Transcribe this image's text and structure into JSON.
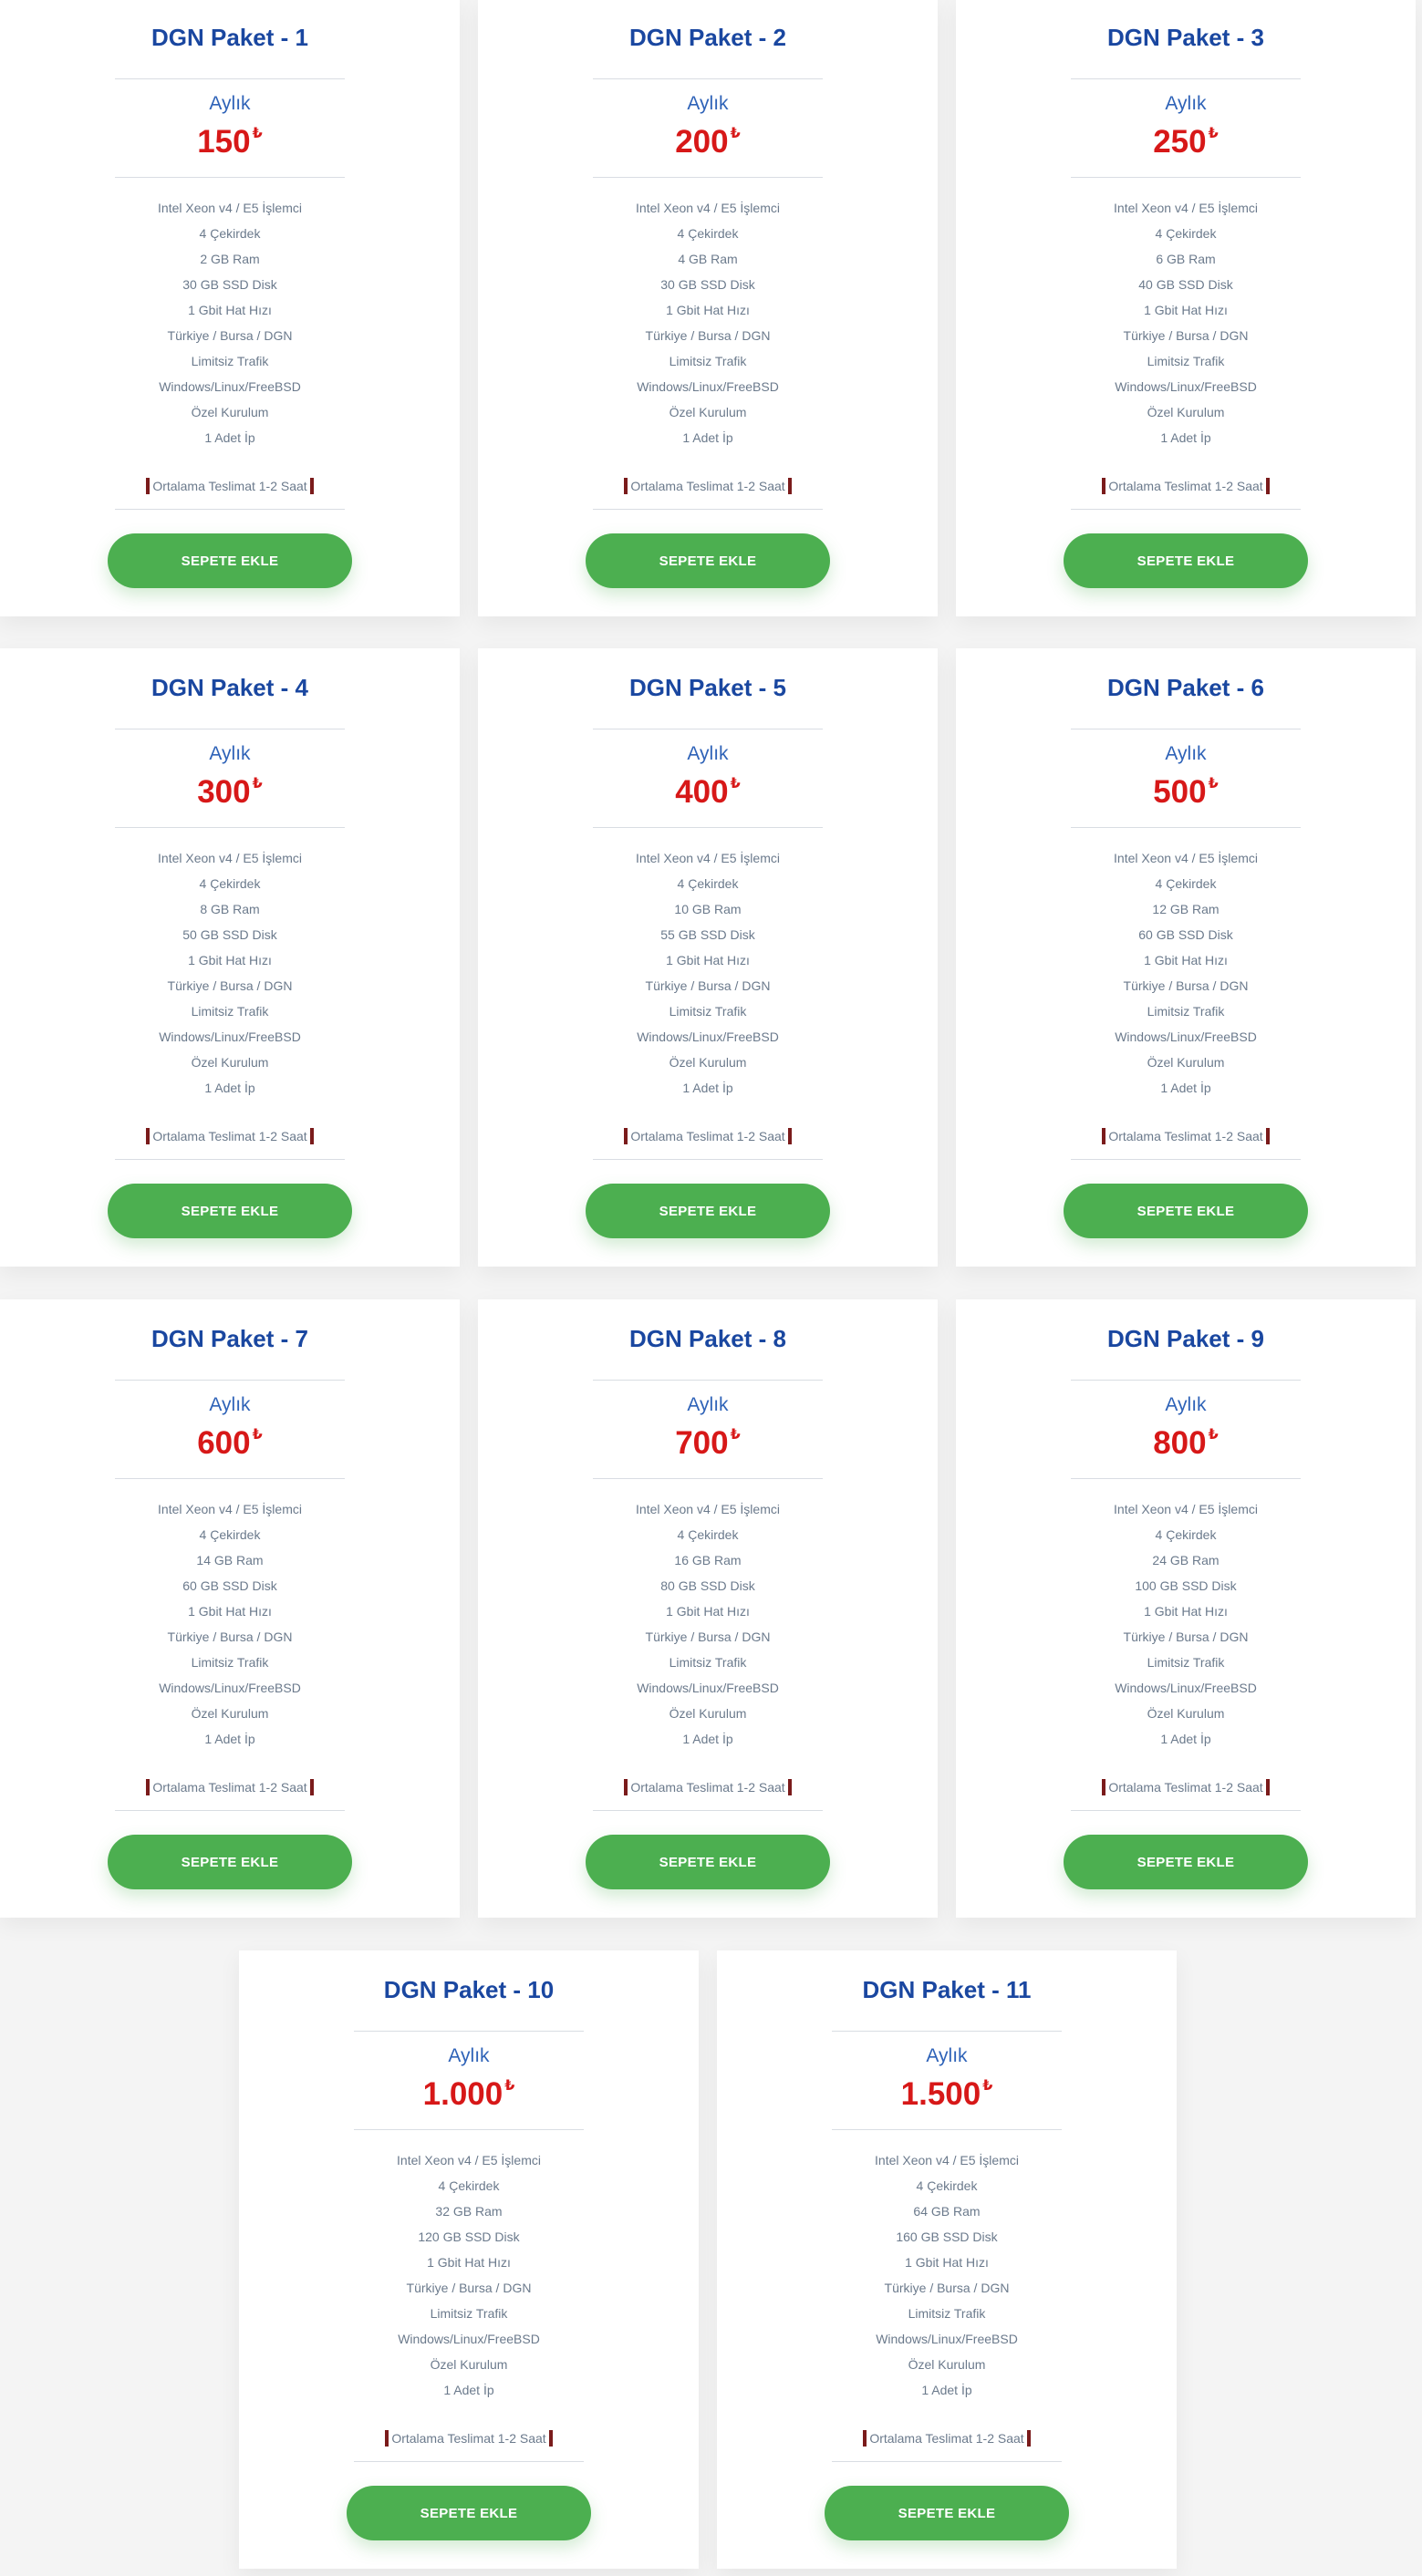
{
  "button_label": "SEPETE EKLE",
  "colors": {
    "title": "#1a47a0",
    "price": "#d71818",
    "button": "#4caf50"
  },
  "packages": [
    {
      "title": "DGN Paket - 1",
      "period": "Aylık",
      "price": "150",
      "currency": "₺",
      "features": [
        "Intel Xeon v4 / E5 İşlemci",
        "4 Çekirdek",
        "2 GB Ram",
        "30 GB SSD Disk",
        "1 Gbit Hat Hızı",
        "Türkiye / Bursa / DGN",
        "Limitsiz Trafik",
        "Windows/Linux/FreeBSD",
        "Özel Kurulum",
        "1 Adet İp"
      ],
      "delivery": "Ortalama Teslimat 1-2 Saat"
    },
    {
      "title": "DGN Paket - 2",
      "period": "Aylık",
      "price": "200",
      "currency": "₺",
      "features": [
        "Intel Xeon v4 / E5 İşlemci",
        "4 Çekirdek",
        "4 GB Ram",
        "30 GB SSD Disk",
        "1 Gbit Hat Hızı",
        "Türkiye / Bursa / DGN",
        "Limitsiz Trafik",
        "Windows/Linux/FreeBSD",
        "Özel Kurulum",
        "1 Adet İp"
      ],
      "delivery": "Ortalama Teslimat 1-2 Saat"
    },
    {
      "title": "DGN Paket - 3",
      "period": "Aylık",
      "price": "250",
      "currency": "₺",
      "features": [
        "Intel Xeon v4 / E5 İşlemci",
        "4 Çekirdek",
        "6 GB Ram",
        "40 GB SSD Disk",
        "1 Gbit Hat Hızı",
        "Türkiye / Bursa / DGN",
        "Limitsiz Trafik",
        "Windows/Linux/FreeBSD",
        "Özel Kurulum",
        "1 Adet İp"
      ],
      "delivery": "Ortalama Teslimat 1-2 Saat"
    },
    {
      "title": "DGN Paket - 4",
      "period": "Aylık",
      "price": "300",
      "currency": "₺",
      "features": [
        "Intel Xeon v4 / E5 İşlemci",
        "4 Çekirdek",
        "8 GB Ram",
        "50 GB SSD Disk",
        "1 Gbit Hat Hızı",
        "Türkiye / Bursa / DGN",
        "Limitsiz Trafik",
        "Windows/Linux/FreeBSD",
        "Özel Kurulum",
        "1 Adet İp"
      ],
      "delivery": "Ortalama Teslimat 1-2 Saat"
    },
    {
      "title": "DGN Paket - 5",
      "period": "Aylık",
      "price": "400",
      "currency": "₺",
      "features": [
        "Intel Xeon v4 / E5 İşlemci",
        "4 Çekirdek",
        "10 GB Ram",
        "55 GB SSD Disk",
        "1 Gbit Hat Hızı",
        "Türkiye / Bursa / DGN",
        "Limitsiz Trafik",
        "Windows/Linux/FreeBSD",
        "Özel Kurulum",
        "1 Adet İp"
      ],
      "delivery": "Ortalama Teslimat 1-2 Saat"
    },
    {
      "title": "DGN Paket - 6",
      "period": "Aylık",
      "price": "500",
      "currency": "₺",
      "features": [
        "Intel Xeon v4 / E5 İşlemci",
        "4 Çekirdek",
        "12 GB Ram",
        "60 GB SSD Disk",
        "1 Gbit Hat Hızı",
        "Türkiye / Bursa / DGN",
        "Limitsiz Trafik",
        "Windows/Linux/FreeBSD",
        "Özel Kurulum",
        "1 Adet İp"
      ],
      "delivery": "Ortalama Teslimat 1-2 Saat"
    },
    {
      "title": "DGN Paket - 7",
      "period": "Aylık",
      "price": "600",
      "currency": "₺",
      "features": [
        "Intel Xeon v4 / E5 İşlemci",
        "4 Çekirdek",
        "14 GB Ram",
        "60 GB SSD Disk",
        "1 Gbit Hat Hızı",
        "Türkiye / Bursa / DGN",
        "Limitsiz Trafik",
        "Windows/Linux/FreeBSD",
        "Özel Kurulum",
        "1 Adet İp"
      ],
      "delivery": "Ortalama Teslimat 1-2 Saat"
    },
    {
      "title": "DGN Paket - 8",
      "period": "Aylık",
      "price": "700",
      "currency": "₺",
      "features": [
        "Intel Xeon v4 / E5 İşlemci",
        "4 Çekirdek",
        "16 GB Ram",
        "80 GB SSD Disk",
        "1 Gbit Hat Hızı",
        "Türkiye / Bursa / DGN",
        "Limitsiz Trafik",
        "Windows/Linux/FreeBSD",
        "Özel Kurulum",
        "1 Adet İp"
      ],
      "delivery": "Ortalama Teslimat 1-2 Saat"
    },
    {
      "title": "DGN Paket - 9",
      "period": "Aylık",
      "price": "800",
      "currency": "₺",
      "features": [
        "Intel Xeon v4 / E5 İşlemci",
        "4 Çekirdek",
        "24 GB Ram",
        "100 GB SSD Disk",
        "1 Gbit Hat Hızı",
        "Türkiye / Bursa / DGN",
        "Limitsiz Trafik",
        "Windows/Linux/FreeBSD",
        "Özel Kurulum",
        "1 Adet İp"
      ],
      "delivery": "Ortalama Teslimat 1-2 Saat"
    },
    {
      "title": "DGN Paket - 10",
      "period": "Aylık",
      "price": "1.000",
      "currency": "₺",
      "features": [
        "Intel Xeon v4 / E5 İşlemci",
        "4 Çekirdek",
        "32 GB Ram",
        "120 GB SSD Disk",
        "1 Gbit Hat Hızı",
        "Türkiye / Bursa / DGN",
        "Limitsiz Trafik",
        "Windows/Linux/FreeBSD",
        "Özel Kurulum",
        "1 Adet İp"
      ],
      "delivery": "Ortalama Teslimat 1-2 Saat"
    },
    {
      "title": "DGN Paket - 11",
      "period": "Aylık",
      "price": "1.500",
      "currency": "₺",
      "features": [
        "Intel Xeon v4 / E5 İşlemci",
        "4 Çekirdek",
        "64 GB Ram",
        "160 GB SSD Disk",
        "1 Gbit Hat Hızı",
        "Türkiye / Bursa / DGN",
        "Limitsiz Trafik",
        "Windows/Linux/FreeBSD",
        "Özel Kurulum",
        "1 Adet İp"
      ],
      "delivery": "Ortalama Teslimat 1-2 Saat"
    }
  ]
}
